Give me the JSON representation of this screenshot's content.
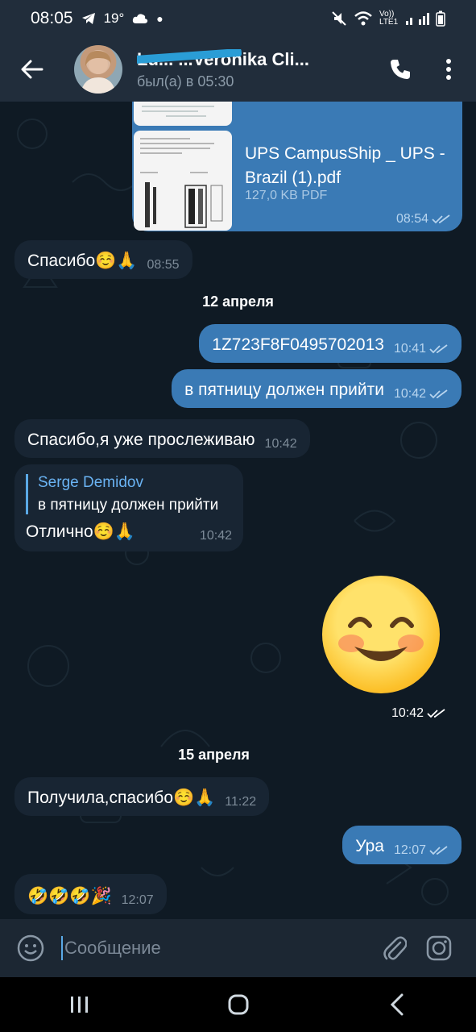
{
  "status_bar": {
    "time": "08:05",
    "temp": "19°",
    "network": "Vo)) LTE1"
  },
  "header": {
    "title": "Lu... ...Veronika Cli...",
    "status": "был(а) в 05:30"
  },
  "file_message": {
    "name": "UPS CampusShip _ UPS - Brazil (1).pdf",
    "meta": "127,0 KB PDF",
    "time": "08:54"
  },
  "messages": [
    {
      "id": "m1",
      "text": "Спасибо☺️🙏",
      "time": "08:55"
    },
    {
      "id": "m2",
      "text": "1Z723F8F0495702013",
      "time": "10:41"
    },
    {
      "id": "m3",
      "text": "в пятницу должен прийти",
      "time": "10:42"
    },
    {
      "id": "m4",
      "text": "Спасибо,я уже прослеживаю",
      "time": "10:42"
    },
    {
      "id": "m5",
      "reply_name": "Serge Demidov",
      "reply_text": "в пятницу должен прийти",
      "text": "Отлично☺️🙏",
      "time": "10:42"
    },
    {
      "id": "m6",
      "time": "10:42"
    },
    {
      "id": "m7",
      "text": "Получила,спасибо☺️🙏",
      "time": "11:22"
    },
    {
      "id": "m8",
      "text": "Ура",
      "time": "12:07"
    },
    {
      "id": "m9",
      "text": "🤣🤣🤣🎉",
      "time": "12:07"
    }
  ],
  "dates": [
    "12 апреля",
    "15 апреля"
  ],
  "input": {
    "placeholder": "Сообщение"
  },
  "colors": {
    "background": "#0f1a24",
    "incoming_bubble": "#182533",
    "outgoing_bubble": "#3a7ab5",
    "header": "#212d3b",
    "accent": "#6ab3f3"
  },
  "icons": {
    "back": "arrow-left-icon",
    "call": "phone-icon",
    "menu": "more-vertical-icon",
    "emoji": "smiley-icon",
    "attach": "paperclip-icon",
    "camera": "instagram-camera-icon"
  }
}
